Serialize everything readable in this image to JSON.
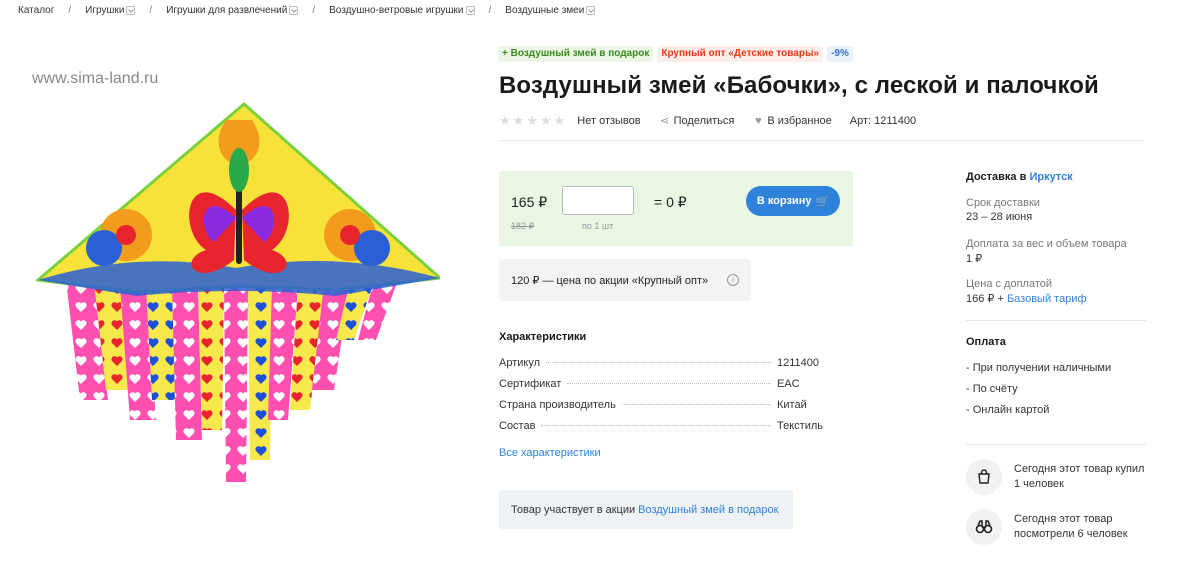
{
  "breadcrumbs": [
    "Каталог",
    "Игрушки",
    "Игрушки для развлечений",
    "Воздушно-ветровые игрушки",
    "Воздушные змеи"
  ],
  "watermark": "www.sima-land.ru",
  "badges": [
    {
      "label": "+ Воздушный змей в подарок",
      "color": "#3a8a1f"
    },
    {
      "label": "Крупный опт «Детские товары»",
      "color": "#e5391a"
    },
    {
      "label": "-9%",
      "color": "#3a6fd1"
    }
  ],
  "product": {
    "title": "Воздушный змей «Бабочки», с леской и палочкой",
    "rating_stars": 0,
    "reviews_label": "Нет отзывов",
    "share_label": "Поделиться",
    "favorite_label": "В избранное",
    "article_label": "Арт: 1211400"
  },
  "buy": {
    "price": "165 ₽",
    "old_price": "182 ₽",
    "quantity_value": "",
    "quantity_hint": "по 1 шт",
    "total": "= 0 ₽",
    "cart_button": "В корзину",
    "accent_color": "#2f82d9",
    "box_color": "#e9f6e4"
  },
  "promo_price": "120 ₽ — цена по акции «Крупный опт»",
  "characteristics": {
    "title": "Характеристики",
    "rows": [
      {
        "key": "Артикул",
        "value": "1211400"
      },
      {
        "key": "Сертификат",
        "value": "EAC"
      },
      {
        "key": "Страна производитель",
        "value": "Китай"
      },
      {
        "key": "Состав",
        "value": "Текстиль"
      }
    ],
    "all_link": "Все характеристики"
  },
  "action": {
    "text": "Товар участвует в акции",
    "link": "Воздушный змей в подарок"
  },
  "delivery": {
    "title_prefix": "Доставка в",
    "city": "Иркутск",
    "term_label": "Срок доставки",
    "term_value": "23 – 28 июня",
    "surcharge_label": "Доплата за вес и объем товара",
    "surcharge_value": "1 ₽",
    "total_label": "Цена с доплатой",
    "total_value": "166 ₽ +",
    "tariff_link": "Базовый тариф"
  },
  "payment": {
    "title": "Оплата",
    "methods": [
      "- При получении наличными",
      "- По счёту",
      "- Онлайн картой"
    ]
  },
  "social": [
    {
      "icon": "shopping-bag-icon",
      "line1": "Сегодня этот товар купил",
      "line2": "1 человек"
    },
    {
      "icon": "binoculars-icon",
      "line1": "Сегодня этот товар",
      "line2": "посмотрели 6 человек"
    }
  ]
}
